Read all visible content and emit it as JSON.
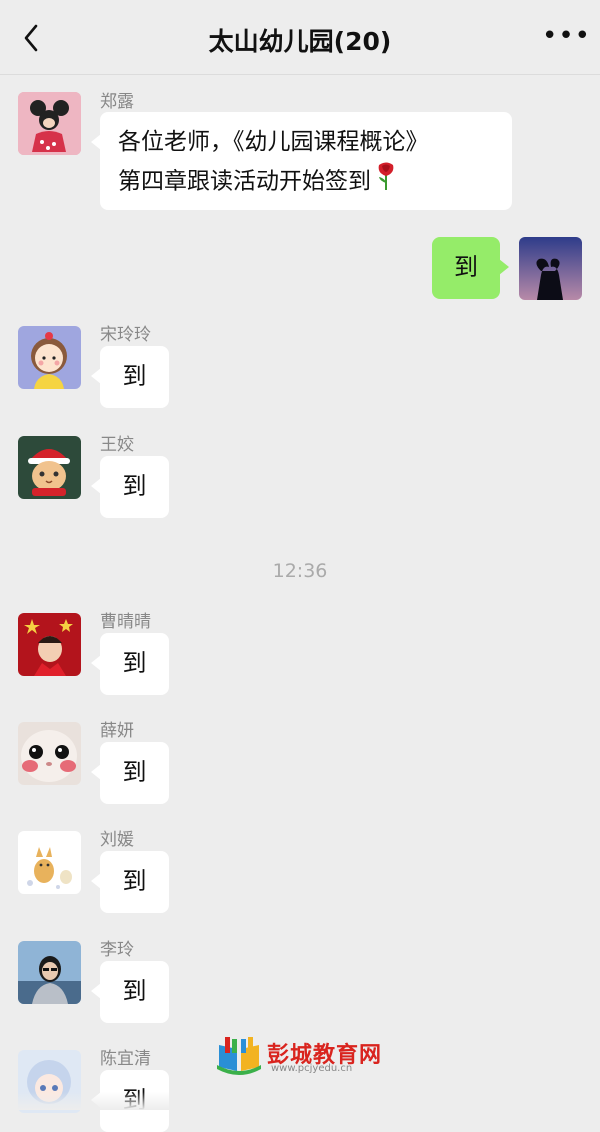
{
  "header": {
    "title": "太山幼儿园(20)",
    "back_icon": "chevron-left-icon",
    "more_icon": "more-horizontal-icon",
    "more_glyph": "•••"
  },
  "messages": [
    {
      "sender": "郑露",
      "text_line1": "各位老师，《幼儿园课程概论》",
      "text_line2": "第四章跟读活动开始签到"
    },
    {
      "self": true,
      "text": "到"
    },
    {
      "sender": "宋玲玲",
      "text": "到"
    },
    {
      "sender": "王姣",
      "text": "到"
    },
    {
      "sender": "曹晴晴",
      "text": "到"
    },
    {
      "sender": "薛妍",
      "text": "到"
    },
    {
      "sender": "刘媛",
      "text": "到"
    },
    {
      "sender": "李玲",
      "text": "到"
    },
    {
      "sender": "陈宜清",
      "text": "到"
    }
  ],
  "timestamp": "12:36",
  "watermark": {
    "text": "彭城教育网",
    "url": "www.pcjyedu.cn"
  },
  "colors": {
    "background": "#ededed",
    "self_bubble": "#95ec69",
    "other_bubble": "#ffffff",
    "watermark": "#d9241e"
  }
}
